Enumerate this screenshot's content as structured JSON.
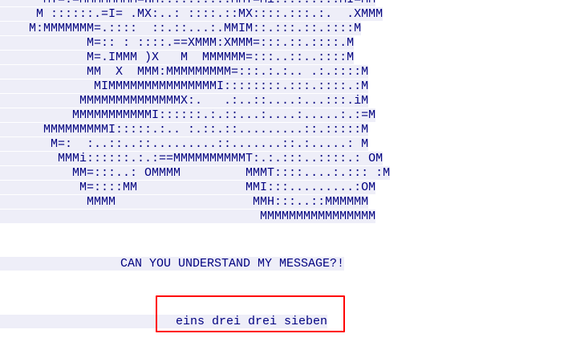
{
  "ascii_art": {
    "lines": [
      "      MT=:=MMMMMMMM=HM::::.:::::MMT=Mi:::::.:::MI=MM",
      "     M ::::::.=I= .MX:..: ::::.::MX::::.:::.:.  .XMMM",
      "    M:MMMMMMM=.::::  ::.::...:.MMIM::.:::.::.::::M",
      "            M=:: : ::::.==XMMM:XMMM=:::.::.::::.M",
      "            M=.IMMM )X   M  MMMMMM=:::..::..::::M",
      "            MM  X  MMM:MMMMMMMMM=:::.:.:.. .:.::::M",
      "             MIMMMMMMMMMMMMMMMI::::::::.:::.::::.:M",
      "           MMMMMMMMMMMMMMX:.   .:..::....:...:::.iM",
      "          MMMMMMMMMMMI::::::.:.::...:....:.....:.:=M",
      "      MMMMMMMMMI:::::.:.. :.::.::.........::.:::::M",
      "       M=:  :..::..::.........::.......::.:.....: M",
      "        MMMi::::::.:.:==MMMMMMMMMMT:.:.:::..::::.: OM",
      "          MM=:::..: OMMMM         MMMT::::....:.::: :M",
      "           M=::::MM               MMI:::.........:OM",
      "            MMMM                   MMH:::..::MMMMMM",
      "                                    MMMMMMMMMMMMMMMM"
    ]
  },
  "message": {
    "text": "CAN YOU UNDERSTAND MY MESSAGE?!"
  },
  "answer": {
    "text": "eins drei drei sieben"
  },
  "colors": {
    "text": "#000080",
    "highlight_bg": "#eeeef8",
    "box_border": "#ff0000"
  }
}
